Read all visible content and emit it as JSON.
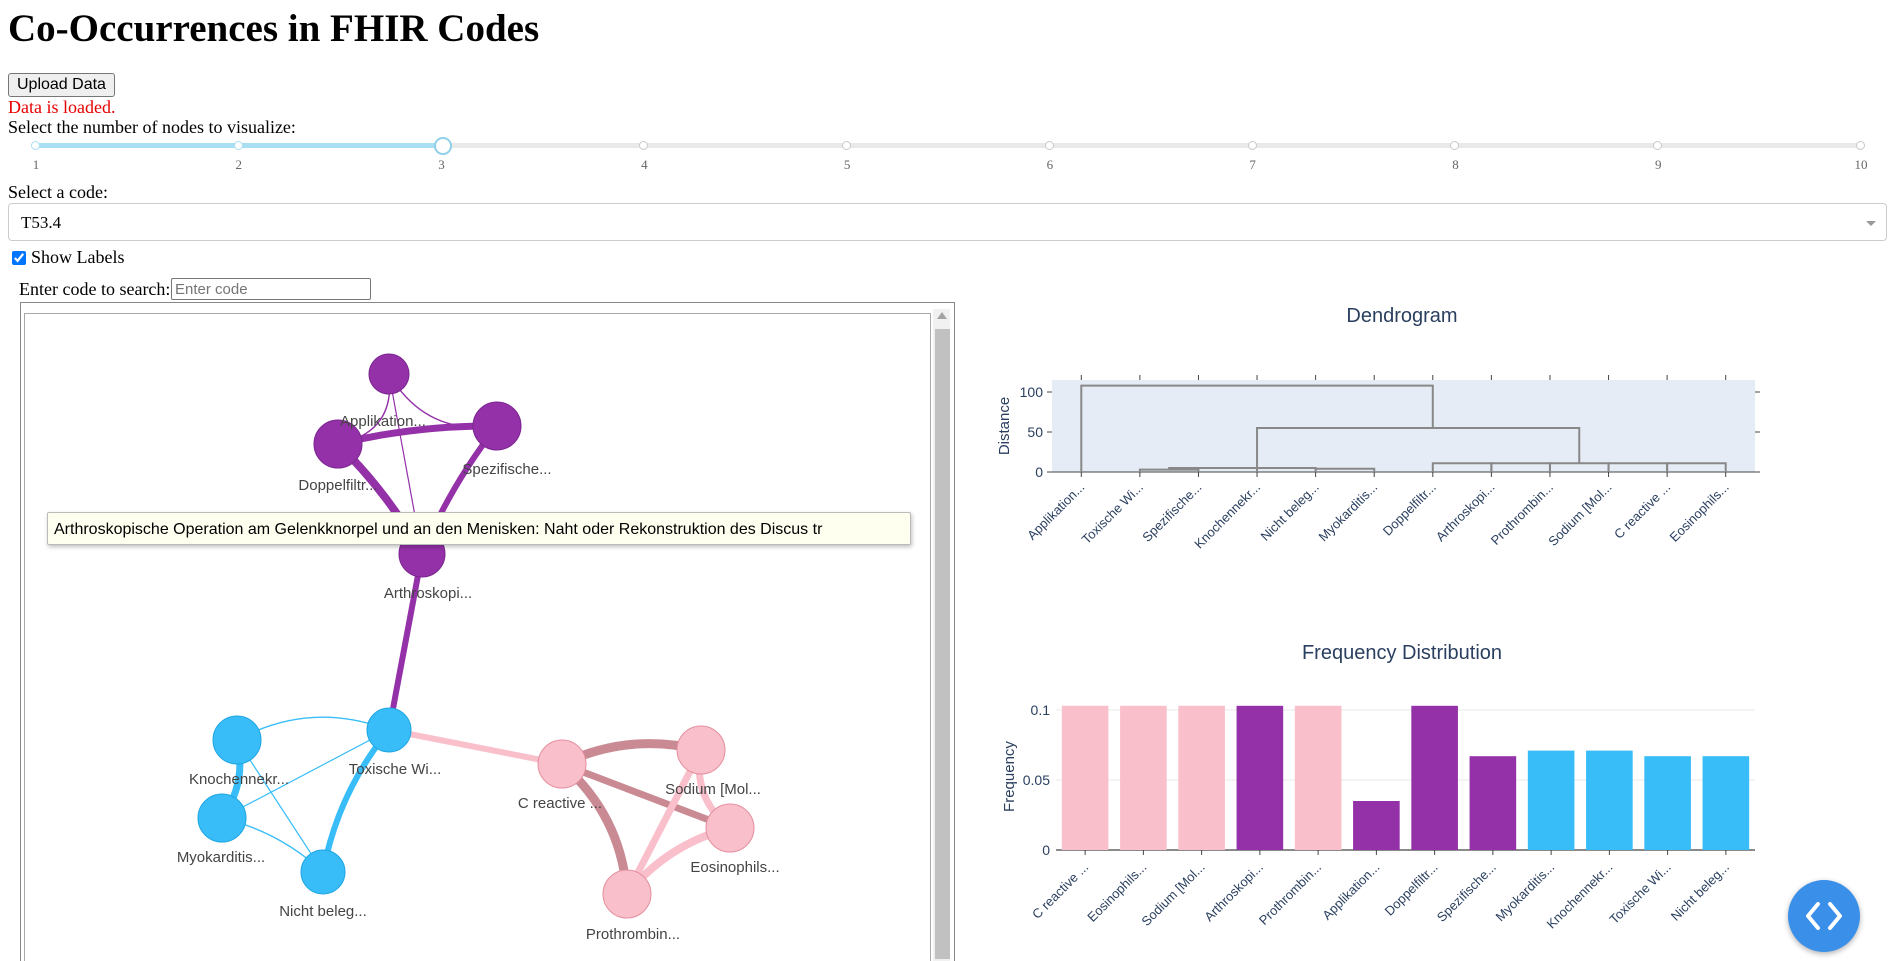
{
  "page": {
    "title": "Co-Occurrences in FHIR Codes",
    "upload_label": "Upload Data",
    "status": "Data is loaded.",
    "slider_label": "Select the number of nodes to visualize:",
    "slider": {
      "min": 1,
      "max": 10,
      "value": 3,
      "ticks": [
        "1",
        "2",
        "3",
        "4",
        "5",
        "6",
        "7",
        "8",
        "9",
        "10"
      ]
    },
    "code_label": "Select a code:",
    "code_value": "T53.4",
    "show_labels_label": "Show Labels",
    "show_labels_checked": true,
    "search_label": "Enter code to search:",
    "search_placeholder": "Enter code"
  },
  "network": {
    "tooltip": "Arthroskopische Operation am Gelenkknorpel und an den Menisken: Naht oder Rekonstruktion des Discus tr",
    "colors": {
      "purple": "#9431a8",
      "blue": "#38bdf8",
      "pink": "#f9bfca",
      "rose": "#c98a93"
    },
    "nodes": [
      {
        "id": "n-top",
        "label": "",
        "color": "purple"
      },
      {
        "id": "n-appl",
        "label": "Applikation...",
        "color": "purple"
      },
      {
        "id": "n-dopp",
        "label": "Doppelfiltr...",
        "color": "purple"
      },
      {
        "id": "n-spez",
        "label": "Spezifische...",
        "color": "purple"
      },
      {
        "id": "n-arth",
        "label": "Arthroskopi...",
        "color": "purple"
      },
      {
        "id": "n-knoc",
        "label": "Knochennekr...",
        "color": "blue"
      },
      {
        "id": "n-toxi",
        "label": "Toxische Wi...",
        "color": "blue"
      },
      {
        "id": "n-myok",
        "label": "Myokarditis...",
        "color": "blue"
      },
      {
        "id": "n-nich",
        "label": "Nicht beleg...",
        "color": "blue"
      },
      {
        "id": "n-crea",
        "label": "C reactive ...",
        "color": "pink"
      },
      {
        "id": "n-sodi",
        "label": "Sodium [Mol...",
        "color": "pink"
      },
      {
        "id": "n-eosi",
        "label": "Eosinophils...",
        "color": "pink"
      },
      {
        "id": "n-prot",
        "label": "Prothrombin...",
        "color": "pink"
      }
    ]
  },
  "dendrogram": {
    "title": "Dendrogram",
    "ylabel": "Distance",
    "yticks": [
      "0",
      "50",
      "100"
    ],
    "ylim": [
      0,
      115
    ],
    "leaves": [
      "Applikation...",
      "Toxische Wi...",
      "Spezifische...",
      "Knochennekr...",
      "Nicht beleg...",
      "Myokarditis...",
      "Doppelfiltr...",
      "Arthroskopi...",
      "Prothrombin...",
      "Sodium [Mol...",
      "C reactive ...",
      "Eosinophils..."
    ],
    "bg_color": "#e5ecf6",
    "line_color": "#888888"
  },
  "frequency": {
    "title": "Frequency Distribution",
    "ylabel": "Frequency",
    "yticks": [
      "0",
      "0.05",
      "0.1"
    ]
  },
  "chart_data": {
    "type": "bar",
    "title": "Frequency Distribution",
    "xlabel": "",
    "ylabel": "Frequency",
    "ylim": [
      0,
      0.105
    ],
    "categories": [
      "C reactive ...",
      "Eosinophils...",
      "Sodium [Mol...",
      "Arthroskopi...",
      "Prothrombin...",
      "Applikation...",
      "Doppelfiltr...",
      "Spezifische...",
      "Myokarditis...",
      "Knochennekr...",
      "Toxische Wi...",
      "Nicht beleg..."
    ],
    "values": [
      0.103,
      0.103,
      0.103,
      0.103,
      0.103,
      0.035,
      0.103,
      0.067,
      0.071,
      0.071,
      0.067,
      0.067
    ],
    "bar_colors": [
      "#f9bfca",
      "#f9bfca",
      "#f9bfca",
      "#9431a8",
      "#f9bfca",
      "#9431a8",
      "#9431a8",
      "#9431a8",
      "#38bdf8",
      "#38bdf8",
      "#38bdf8",
      "#38bdf8"
    ],
    "grid": true
  }
}
